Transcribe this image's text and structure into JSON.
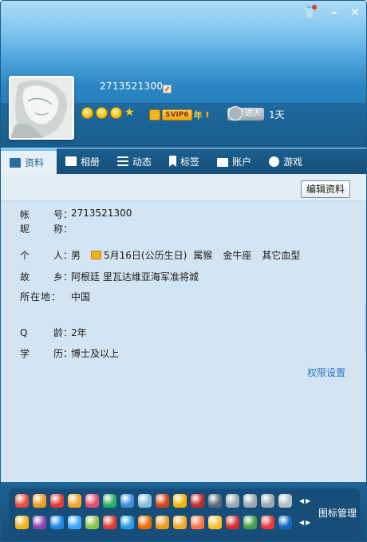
{
  "header": {
    "qq_number": "2713521300",
    "talent_label": "达人",
    "days": "1天",
    "svip_label": "SVIP6",
    "svip_year": "年"
  },
  "tabs": [
    {
      "label": "资料",
      "icon": "profile-card-icon"
    },
    {
      "label": "相册",
      "icon": "photo-album-icon"
    },
    {
      "label": "动态",
      "icon": "feed-list-icon"
    },
    {
      "label": "标签",
      "icon": "bookmark-icon"
    },
    {
      "label": "账户",
      "icon": "wallet-icon"
    },
    {
      "label": "游戏",
      "icon": "game-icon"
    }
  ],
  "buttons": {
    "edit_profile": "编辑资料"
  },
  "fields": {
    "account": {
      "label_a": "帐",
      "label_b": "号：",
      "value": "2713521300"
    },
    "nickname": {
      "label_a": "昵",
      "label_b": "称：",
      "value": ""
    },
    "personal": {
      "label_a": "个",
      "label_b": "人：",
      "gender": "男",
      "birthday": "5月16日(公历生日)",
      "zodiac": "属猴",
      "constellation": "金牛座",
      "blood_type": "其它血型"
    },
    "hometown": {
      "label_a": "故",
      "label_b": "乡：",
      "value": "阿根廷 里瓦达维亚海军准将城"
    },
    "location": {
      "label_a": "所在地",
      "label_b": "：",
      "value": "中国"
    },
    "qage": {
      "label_a": "Q",
      "label_b": "龄：",
      "value": "2年"
    },
    "education": {
      "label_a": "学",
      "label_b": "历：",
      "value": "博士及以上"
    }
  },
  "links": {
    "permissions": "权限设置"
  },
  "tray": {
    "icon_manager": "图标管理",
    "row1_colors": [
      "#e84b3c",
      "#f09a1c",
      "#e53935",
      "#f6a623",
      "#e94b6a",
      "#27ae60",
      "#3d8ed8",
      "#7fbcd8",
      "#d84315",
      "#f4b400",
      "#c62828",
      "#5a6b78",
      "#9aa7b1",
      "#9aa7b1",
      "#9aa7b1",
      "#b0bec5"
    ],
    "row2_colors": [
      "#f3b31d",
      "#8e44ad",
      "#1e88e5",
      "#3fa9f5",
      "#8bc34a",
      "#e53935",
      "#2d9cdb",
      "#ef6c00",
      "#f09a1c",
      "#f6a623",
      "#ff7043",
      "#fbc02d",
      "#d32f2f",
      "#43a047",
      "#e53935",
      "#1565c0"
    ]
  },
  "colors": {
    "accent": "#1b5f8f",
    "link": "#2a74c2",
    "panel": "#d3e5f2"
  }
}
